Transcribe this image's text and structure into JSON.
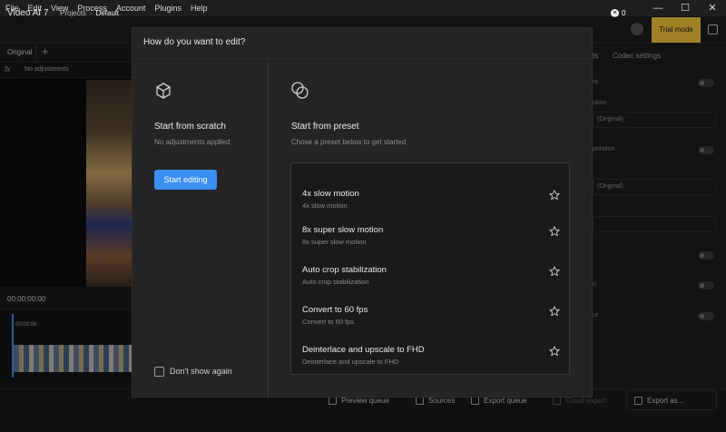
{
  "menu": [
    "File",
    "Edit",
    "View",
    "Process",
    "Account",
    "Plugins",
    "Help"
  ],
  "window_controls": {
    "minimize": "—",
    "maximize": "☐",
    "close": "✕"
  },
  "header": {
    "app_title": "Video AI 7",
    "breadcrumb_root": "Projects",
    "breadcrumb_current": "Default",
    "credits": "0",
    "trial_label": "Trial mode"
  },
  "left": {
    "tab_original": "Original",
    "adjustments_label": "No adjustments",
    "timecode": "00:00:00:00",
    "timeline_time": "00:00:00"
  },
  "right_panel": {
    "tab_settings_partial": "ts",
    "tab_codec": "Codec settings",
    "labels": [
      "nt",
      "ution",
      "polation",
      "n",
      "ur"
    ],
    "selects": [
      "(Original)",
      "(Original)",
      ""
    ]
  },
  "bottom_bar": {
    "preview_queue": "Preview queue",
    "sources": "Sources",
    "export_queue": "Export queue",
    "cloud_export": "Cloud export",
    "export_as": "Export as..."
  },
  "modal": {
    "title": "How do you want to edit?",
    "scratch": {
      "title": "Start from scratch",
      "subtitle": "No adjustments applied",
      "button": "Start editing"
    },
    "dont_show_again": "Don't show again",
    "preset": {
      "title": "Start from preset",
      "subtitle": "Chose a preset below to get started",
      "items": [
        {
          "name": "4x slow motion",
          "desc": "4x slow motion"
        },
        {
          "name": "8x super slow motion",
          "desc": "8x super slow motion"
        },
        {
          "name": "Auto crop stabilization",
          "desc": "Auto crop stabilization"
        },
        {
          "name": "Convert to 60 fps",
          "desc": "Convert to 60 fps"
        },
        {
          "name": "Deinterlace and upscale to FHD",
          "desc": "Deinterlace and upscale to FHD"
        }
      ]
    }
  },
  "colors": {
    "accent": "#3b8ff3",
    "trial": "#f6c63b",
    "modal_bg": "#242424"
  }
}
